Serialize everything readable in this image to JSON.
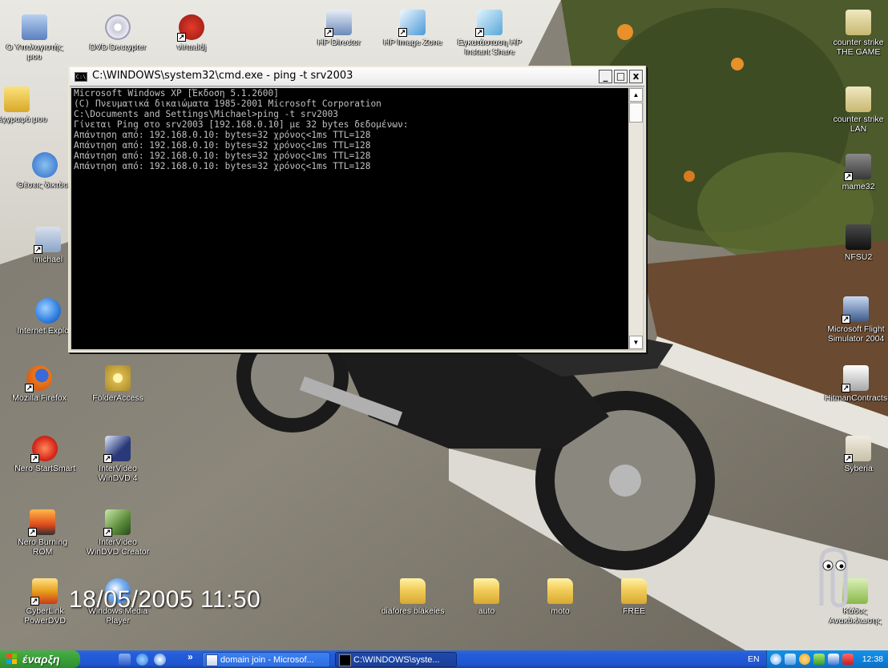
{
  "desktop": {
    "icons_left": [
      {
        "label": "Ο Υπολογιστής μου",
        "icon": "my-computer-icon",
        "color": "#7fa8d8"
      },
      {
        "label": "DVD Decrypter",
        "icon": "dvd-disc-icon",
        "color": "#d8d8e8"
      },
      {
        "label": "virtualdj",
        "icon": "virtualdj-icon",
        "color": "#c0241c"
      },
      {
        "label": "Τα έγγραφά μου",
        "icon": "my-documents-icon",
        "color": "#f2d35c"
      },
      {
        "label": "Θέσεις δικτύου",
        "icon": "network-places-icon",
        "color": "#4a88d8"
      },
      {
        "label": "michael",
        "icon": "user-folder-icon",
        "color": "#8aa4c8"
      },
      {
        "label": "Internet Explorer",
        "icon": "internet-explorer-icon",
        "color": "#2e7de0"
      },
      {
        "label": "Mozilla Firefox",
        "icon": "firefox-icon",
        "color": "#e8781c"
      },
      {
        "label": "FolderAccess",
        "icon": "folder-access-icon",
        "color": "#d8b84a"
      },
      {
        "label": "Nero StartSmart",
        "icon": "nero-startsmart-icon",
        "color": "#d82a1c"
      },
      {
        "label": "InterVideo WinDVD 4",
        "icon": "windvd-icon",
        "color": "#2a3a78"
      },
      {
        "label": "Nero Burning ROM",
        "icon": "nero-burning-icon",
        "color": "#e04a1c"
      },
      {
        "label": "InterVideo WinDVD Creator",
        "icon": "windvd-creator-icon",
        "color": "#5a8a3a"
      },
      {
        "label": "CyberLink PowerDVD",
        "icon": "powerdvd-icon",
        "color": "#e8a01c"
      },
      {
        "label": "Windows Media Player",
        "icon": "media-player-icon",
        "color": "#2a6ad8"
      }
    ],
    "icons_top": [
      {
        "label": "HP Director",
        "icon": "hp-director-icon",
        "color": "#6a8ab8"
      },
      {
        "label": "HP Image Zone",
        "icon": "hp-image-zone-icon",
        "color": "#4a9ad8"
      },
      {
        "label": "Εγκατάσταση HP Instant Share",
        "icon": "hp-instant-share-icon",
        "color": "#58a8d8"
      }
    ],
    "icons_right": [
      {
        "label": "counter strike THE GAME",
        "icon": "counter-strike-icon",
        "color": "#c8b870"
      },
      {
        "label": "counter strike LAN",
        "icon": "counter-strike-lan-icon",
        "color": "#c8b870"
      },
      {
        "label": "mame32",
        "icon": "mame32-icon",
        "color": "#585858"
      },
      {
        "label": "NFSU2",
        "icon": "nfsu2-icon",
        "color": "#2a2a2a"
      },
      {
        "label": "Microsoft Flight Simulator 2004",
        "icon": "flight-simulator-icon",
        "color": "#3a5a8a"
      },
      {
        "label": "HitmanContracts",
        "icon": "hitman-icon",
        "color": "#d8d8d8"
      },
      {
        "label": "Syberia",
        "icon": "syberia-icon",
        "color": "#c8c0a8"
      },
      {
        "label": "Κάδος Ανακύκλωσης",
        "icon": "recycle-bin-icon",
        "color": "#8ab848"
      }
    ],
    "icons_bottom": [
      {
        "label": "diafores blakeies",
        "icon": "folder-icon",
        "color": "#f4d060"
      },
      {
        "label": "auto",
        "icon": "folder-icon",
        "color": "#f4d060"
      },
      {
        "label": "moto",
        "icon": "folder-icon",
        "color": "#f4d060"
      },
      {
        "label": "FREE",
        "icon": "folder-icon",
        "color": "#f4d060"
      }
    ],
    "timestamp": "18/05/2005 11:50"
  },
  "cmd_window": {
    "title": "C:\\WINDOWS\\system32\\cmd.exe - ping -t srv2003",
    "icon_text": "C:\\",
    "minimize": "_",
    "maximize": "□",
    "close": "x",
    "lines": [
      "Microsoft Windows XP [Έκδοση 5.1.2600]",
      "(C) Πνευματικά δικαιώματα 1985-2001 Microsoft Corporation",
      "",
      "C:\\Documents and Settings\\Michael>ping -t srv2003",
      "",
      "Γίνεται Ping στο srv2003 [192.168.0.10] με 32 bytes δεδομένων:",
      "",
      "Απάντηση από: 192.168.0.10: bytes=32 χρόνος<1ms TTL=128",
      "Απάντηση από: 192.168.0.10: bytes=32 χρόνος<1ms TTL=128",
      "Απάντηση από: 192.168.0.10: bytes=32 χρόνος<1ms TTL=128",
      "Απάντηση από: 192.168.0.10: bytes=32 χρόνος<1ms TTL=128"
    ]
  },
  "taskbar": {
    "start_label": "έναρξη",
    "chevron": "»",
    "tasks": [
      {
        "label": "domain join - Microsof...",
        "icon": "word-document-icon"
      },
      {
        "label": "C:\\WINDOWS\\syste...",
        "icon": "cmd-icon"
      }
    ],
    "tray": {
      "language": "EN",
      "clock": "12:38"
    }
  }
}
